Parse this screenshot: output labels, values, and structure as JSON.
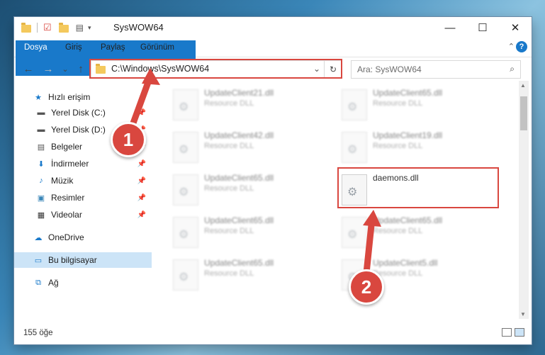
{
  "window": {
    "title": "SysWOW64",
    "minimize": "—",
    "maximize": "☐",
    "close": "✕"
  },
  "ribbon": {
    "tabs": [
      "Dosya",
      "Giriş",
      "Paylaş",
      "Görünüm"
    ],
    "collapse": "⌃",
    "help": "?"
  },
  "address": {
    "path": "C:\\Windows\\SysWOW64",
    "dropdown": "⌄",
    "refresh": "↻"
  },
  "search": {
    "placeholder": "Ara: SysWOW64"
  },
  "nav": {
    "back": "←",
    "forward": "→",
    "recent": "⌄",
    "up": "↑",
    "items": [
      {
        "label": "Hızlı erişim",
        "icon": "star-icon",
        "pinned": false
      },
      {
        "label": "Yerel Disk (C:)",
        "icon": "drive-icon",
        "pinned": true
      },
      {
        "label": "Yerel Disk (D:)",
        "icon": "drive-icon",
        "pinned": true
      },
      {
        "label": "Belgeler",
        "icon": "documents-icon",
        "pinned": true
      },
      {
        "label": "İndirmeler",
        "icon": "download-icon",
        "pinned": true
      },
      {
        "label": "Müzik",
        "icon": "music-icon",
        "pinned": true
      },
      {
        "label": "Resimler",
        "icon": "pictures-icon",
        "pinned": true
      },
      {
        "label": "Videolar",
        "icon": "videos-icon",
        "pinned": true
      },
      {
        "label": "OneDrive",
        "icon": "cloud-icon",
        "pinned": false
      },
      {
        "label": "Bu bilgisayar",
        "icon": "computer-icon",
        "pinned": false
      },
      {
        "label": "Ağ",
        "icon": "network-icon",
        "pinned": false
      }
    ]
  },
  "files": [
    {
      "name": "UpdateClient21.dll",
      "type": "Resource DLL",
      "highlighted": false
    },
    {
      "name": "UpdateClient65.dll",
      "type": "Resource DLL",
      "highlighted": false
    },
    {
      "name": "UpdateClient42.dll",
      "type": "Resource DLL",
      "highlighted": false
    },
    {
      "name": "UpdateClient19.dll",
      "type": "Resource DLL",
      "highlighted": false
    },
    {
      "name": "UpdateClient65.dll",
      "type": "Resource DLL",
      "highlighted": false
    },
    {
      "name": "daemons.dll",
      "type": "",
      "highlighted": true
    },
    {
      "name": "UpdateClient65.dll",
      "type": "Resource DLL",
      "highlighted": false
    },
    {
      "name": "UpdateClient65.dll",
      "type": "Resource DLL",
      "highlighted": false
    },
    {
      "name": "UpdateClient65.dll",
      "type": "Resource DLL",
      "highlighted": false
    },
    {
      "name": "UpdateClient5.dll",
      "type": "Resource DLL",
      "highlighted": false
    }
  ],
  "status": {
    "count": "155 öğe"
  },
  "callouts": [
    "1",
    "2"
  ],
  "colors": {
    "accent": "#1979ca",
    "highlight": "#d9473f",
    "selection": "#cce4f7"
  }
}
